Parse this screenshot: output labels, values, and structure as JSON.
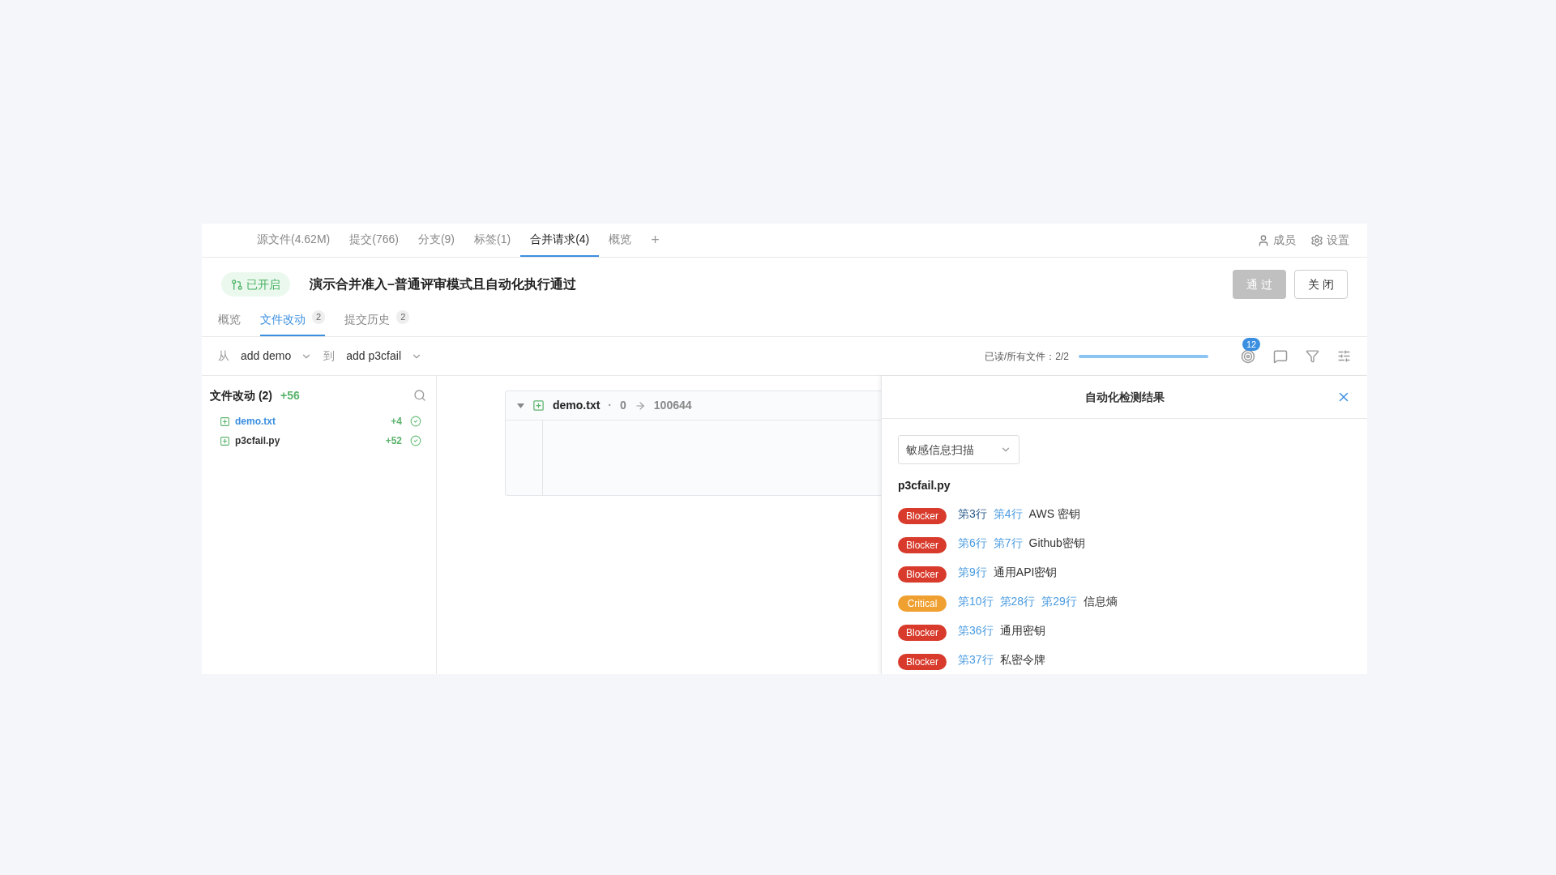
{
  "nav": {
    "tabs": [
      {
        "label": "源文件(4.62M)",
        "selected": false
      },
      {
        "label": "提交(766)",
        "selected": false
      },
      {
        "label": "分支(9)",
        "selected": false
      },
      {
        "label": "标签(1)",
        "selected": false
      },
      {
        "label": "合并请求(4)",
        "selected": true
      },
      {
        "label": "概览",
        "selected": false
      }
    ],
    "add": "+",
    "members": "成员",
    "settings": "设置"
  },
  "request": {
    "status": "已开启",
    "title": "演示合并准入–普通评审模式且自动化执行通过",
    "approve": {
      "label": "通 过",
      "disabled": true
    },
    "close": "关 闭"
  },
  "subtabs": [
    {
      "label": "概览",
      "selected": false
    },
    {
      "label": "文件改动",
      "count": "2",
      "selected": true
    },
    {
      "label": "提交历史",
      "count": "2",
      "selected": false
    }
  ],
  "toolbar": {
    "from_label": "从",
    "from": "add demo",
    "to_label": "到",
    "to": "add p3cfail",
    "read_label": "已读/所有文件：2/2",
    "level": 1,
    "badge": "12"
  },
  "files": {
    "title": "文件改动 (2)",
    "total": "+56",
    "items": [
      {
        "name": "demo.txt",
        "added": "+4",
        "selected": true
      },
      {
        "name": "p3cfail.py",
        "added": "+52",
        "selected": false
      }
    ]
  },
  "diff": {
    "file": "demo.txt",
    "sep": "·",
    "old_mode": "0",
    "new_mode": "100644",
    "expanded": true
  },
  "panel": {
    "title": "自动化检测结果",
    "scanner": "敏感信息扫描",
    "file": "p3cfail.py",
    "results": [
      {
        "severity": "Blocker",
        "kind": "blocker",
        "lines": [
          {
            "label": "第3行",
            "visited": true
          },
          {
            "label": "第4行",
            "visited": false
          }
        ],
        "rule": "AWS 密钥"
      },
      {
        "severity": "Blocker",
        "kind": "blocker",
        "lines": [
          {
            "label": "第6行",
            "visited": false
          },
          {
            "label": "第7行",
            "visited": false
          }
        ],
        "rule": "Github密钥"
      },
      {
        "severity": "Blocker",
        "kind": "blocker",
        "lines": [
          {
            "label": "第9行",
            "visited": false
          }
        ],
        "rule": "通用API密钥"
      },
      {
        "severity": "Critical",
        "kind": "critical",
        "lines": [
          {
            "label": "第10行",
            "visited": false
          },
          {
            "label": "第28行",
            "visited": false
          },
          {
            "label": "第29行",
            "visited": false
          }
        ],
        "rule": "信息熵"
      },
      {
        "severity": "Blocker",
        "kind": "blocker",
        "lines": [
          {
            "label": "第36行",
            "visited": false
          }
        ],
        "rule": "通用密钥"
      },
      {
        "severity": "Blocker",
        "kind": "blocker",
        "lines": [
          {
            "label": "第37行",
            "visited": false
          }
        ],
        "rule": "私密令牌"
      }
    ]
  }
}
